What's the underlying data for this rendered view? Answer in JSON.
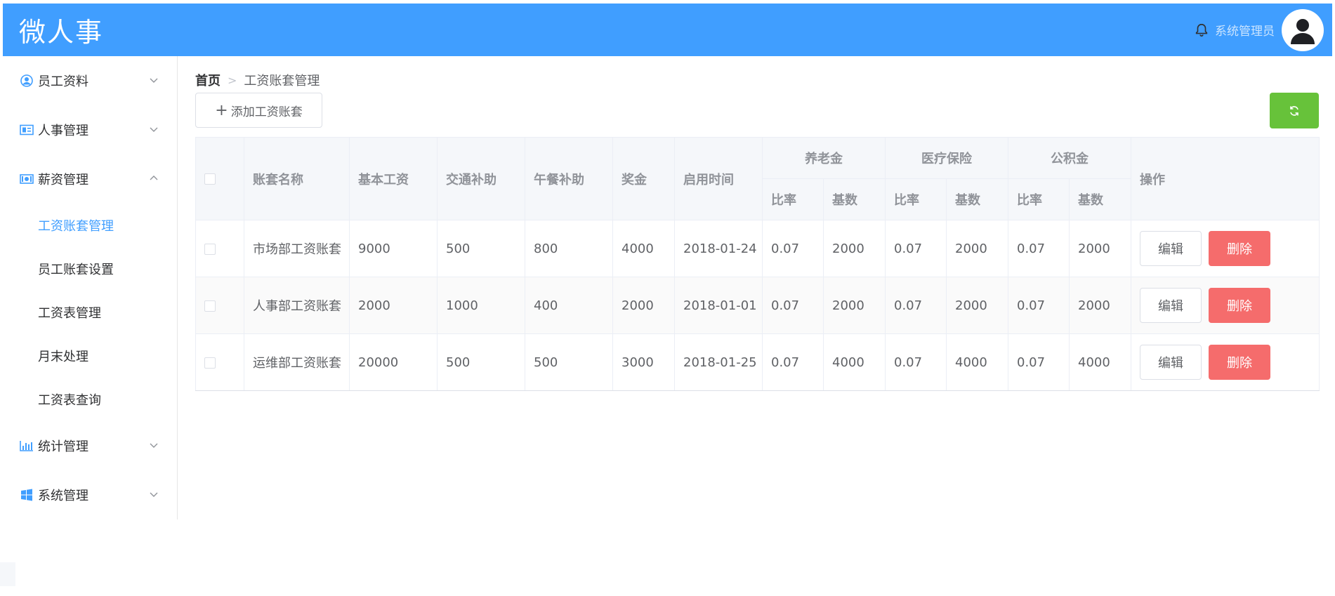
{
  "header": {
    "brand": "微人事",
    "user_name": "系统管理员",
    "accent_color": "#409eff",
    "icons": [
      "bell-icon",
      "user-avatar-icon"
    ]
  },
  "sidebar": {
    "menus": [
      {
        "label": "员工资料",
        "icon": "user-circle-icon",
        "expanded": false
      },
      {
        "label": "人事管理",
        "icon": "id-card-icon",
        "expanded": false
      },
      {
        "label": "薪资管理",
        "icon": "money-icon",
        "expanded": true,
        "children": [
          {
            "label": "工资账套管理",
            "active": true
          },
          {
            "label": "员工账套设置"
          },
          {
            "label": "工资表管理"
          },
          {
            "label": "月末处理"
          },
          {
            "label": "工资表查询"
          }
        ]
      },
      {
        "label": "统计管理",
        "icon": "bar-chart-icon",
        "expanded": false
      },
      {
        "label": "系统管理",
        "icon": "windows-icon",
        "expanded": false
      }
    ]
  },
  "breadcrumb": {
    "home": "首页",
    "separator": ">",
    "current": "工资账套管理"
  },
  "toolbar": {
    "add_label": "添加工资账套",
    "refresh_icon": "refresh-icon",
    "refresh_color": "#67c23a"
  },
  "table": {
    "headers": {
      "name": "账套名称",
      "basic": "基本工资",
      "traffic": "交通补助",
      "lunch": "午餐补助",
      "bonus": "奖金",
      "start_date": "启用时间",
      "pension": "养老金",
      "medical": "医疗保险",
      "fund": "公积金",
      "rate": "比率",
      "base": "基数",
      "ops": "操作"
    },
    "rows": [
      {
        "name": "市场部工资账套",
        "basic": "9000",
        "traffic": "500",
        "lunch": "800",
        "bonus": "4000",
        "start_date": "2018-01-24",
        "pension_rate": "0.07",
        "pension_base": "2000",
        "medical_rate": "0.07",
        "medical_base": "2000",
        "fund_rate": "0.07",
        "fund_base": "2000"
      },
      {
        "name": "人事部工资账套",
        "basic": "2000",
        "traffic": "1000",
        "lunch": "400",
        "bonus": "2000",
        "start_date": "2018-01-01",
        "pension_rate": "0.07",
        "pension_base": "2000",
        "medical_rate": "0.07",
        "medical_base": "2000",
        "fund_rate": "0.07",
        "fund_base": "2000"
      },
      {
        "name": "运维部工资账套",
        "basic": "20000",
        "traffic": "500",
        "lunch": "500",
        "bonus": "3000",
        "start_date": "2018-01-25",
        "pension_rate": "0.07",
        "pension_base": "4000",
        "medical_rate": "0.07",
        "medical_base": "4000",
        "fund_rate": "0.07",
        "fund_base": "4000"
      }
    ],
    "edit_label": "编辑",
    "delete_label": "删除",
    "delete_color": "#f56c6c"
  }
}
